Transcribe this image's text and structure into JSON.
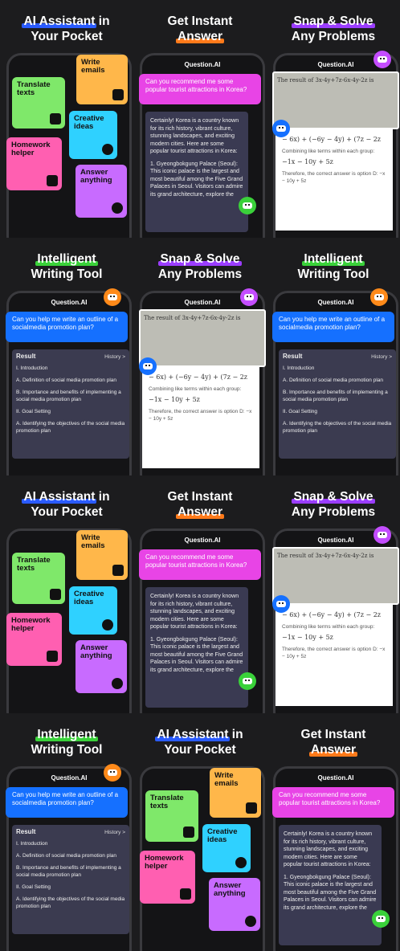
{
  "assistant": {
    "title_l1": "AI Assistant in",
    "title_hl": "AI Assistant",
    "title_rest": " in",
    "title_l2": "Your Pocket",
    "tiles": [
      "Write emails",
      "Translate texts",
      "Creative ideas",
      "Homework helper",
      "Answer anything"
    ]
  },
  "instant": {
    "title_l1": "Get Instant",
    "title_l2": "Answer",
    "header": "Question.AI",
    "question": "Can you recommend me some popular tourist attractions in Korea?",
    "answer_p1": "Certainly! Korea is a country known for its rich history, vibrant culture, stunning landscapes, and exciting modern cities. Here are some popular tourist attractions in Korea:",
    "answer_p2": "1. Gyeongbokgung Palace (Seoul): This iconic palace is the largest and most beautiful among the Five Grand Palaces in Seoul. Visitors can admire its grand architecture, explore the"
  },
  "snap": {
    "title_l1": "Snap & Solve",
    "title_l2": "Any Problems",
    "header": "Question.AI",
    "photo_text": "The result of 3x-4y+7z-6x-4y-2z is",
    "eq": "− 6x) + (−6y − 4y) + (7z − 2z",
    "line1": "Combining like terms within each group:",
    "eq2": "−1x − 10y + 5z",
    "line2": "Therefore, the correct answer is option D: −x − 10y + 5z"
  },
  "writing": {
    "title_l1": "Intelligent",
    "title_l2": "Writing Tool",
    "header": "Question.AI",
    "question": "Can you help me write an outline of a socialmedia promotion plan?",
    "result": "Result",
    "history": "History >",
    "items": [
      "I. Introduction",
      "A. Definition of social media promotion plan",
      "B. Importance and benefits of implementing a social media promotion plan",
      "II. Goal Setting",
      "A. Identifying the objectives of the social media promotion plan"
    ]
  },
  "colors": {
    "bg": "#1c1c1e",
    "pink": "#e844e6",
    "blue": "#1570ff",
    "green": "#3ad13a",
    "orange": "#ff7a1a"
  }
}
